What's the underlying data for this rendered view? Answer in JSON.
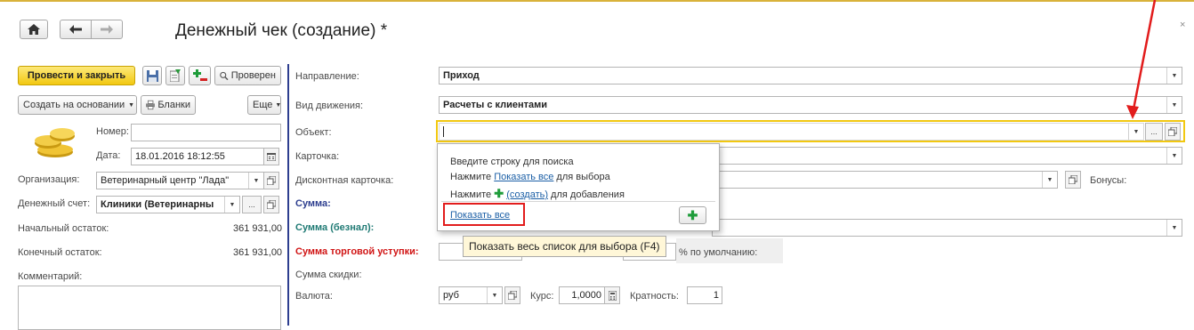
{
  "window": {
    "title": "Денежный чек (создание) *",
    "close_icon": "×"
  },
  "toolbar": {
    "post_close": "Провести и закрыть",
    "checked": "Проверен",
    "create_based": "Создать на основании",
    "forms": "Бланки",
    "more": "Еще"
  },
  "left": {
    "number_label": "Номер:",
    "number_value": "",
    "date_label": "Дата:",
    "date_value": "18.01.2016 18:12:55",
    "org_label": "Организация:",
    "org_value": "Ветеринарный центр \"Лада\"",
    "account_label": "Денежный счет:",
    "account_value": "Клиники (Ветеринарны",
    "start_balance_label": "Начальный остаток:",
    "start_balance_value": "361 931,00",
    "end_balance_label": "Конечный остаток:",
    "end_balance_value": "361 931,00",
    "comment_label": "Комментарий:"
  },
  "right": {
    "direction_label": "Направление:",
    "direction_value": "Приход",
    "movement_label": "Вид движения:",
    "movement_value": "Расчеты с клиентами",
    "object_label": "Объект:",
    "object_value": "",
    "card_label": "Карточка:",
    "discount_card_label": "Дисконтная карточка:",
    "bonuses_label": "Бонусы:",
    "sum_label": "Сумма:",
    "sum_cashless_label": "Сумма (безнал):",
    "trade_discount_label": "Сумма торговой уступки:",
    "default_percent": "% по умолчанию:",
    "discount_sum_label": "Сумма скидки:",
    "currency_label": "Валюта:",
    "currency_value": "руб",
    "rate_label": "Курс:",
    "rate_value": "1,0000",
    "multiplicity_label": "Кратность:",
    "multiplicity_value": "1"
  },
  "popup": {
    "line1": "Введите строку для поиска",
    "line2_pre": "Нажмите ",
    "line2_link": "Показать все",
    "line2_post": " для выбора",
    "line3_pre": "Нажмите ",
    "line3_link": "(создать)",
    "line3_post": " для добавления",
    "show_all": "Показать все"
  },
  "tooltip": "Показать весь список для выбора (F4)",
  "colors": {
    "accent_yellow": "#f2c811",
    "annotation_red": "#e21c1c",
    "section_bar": "#2d3e8f",
    "link": "#1b5fa6",
    "green_plus": "#1e9c3a"
  }
}
